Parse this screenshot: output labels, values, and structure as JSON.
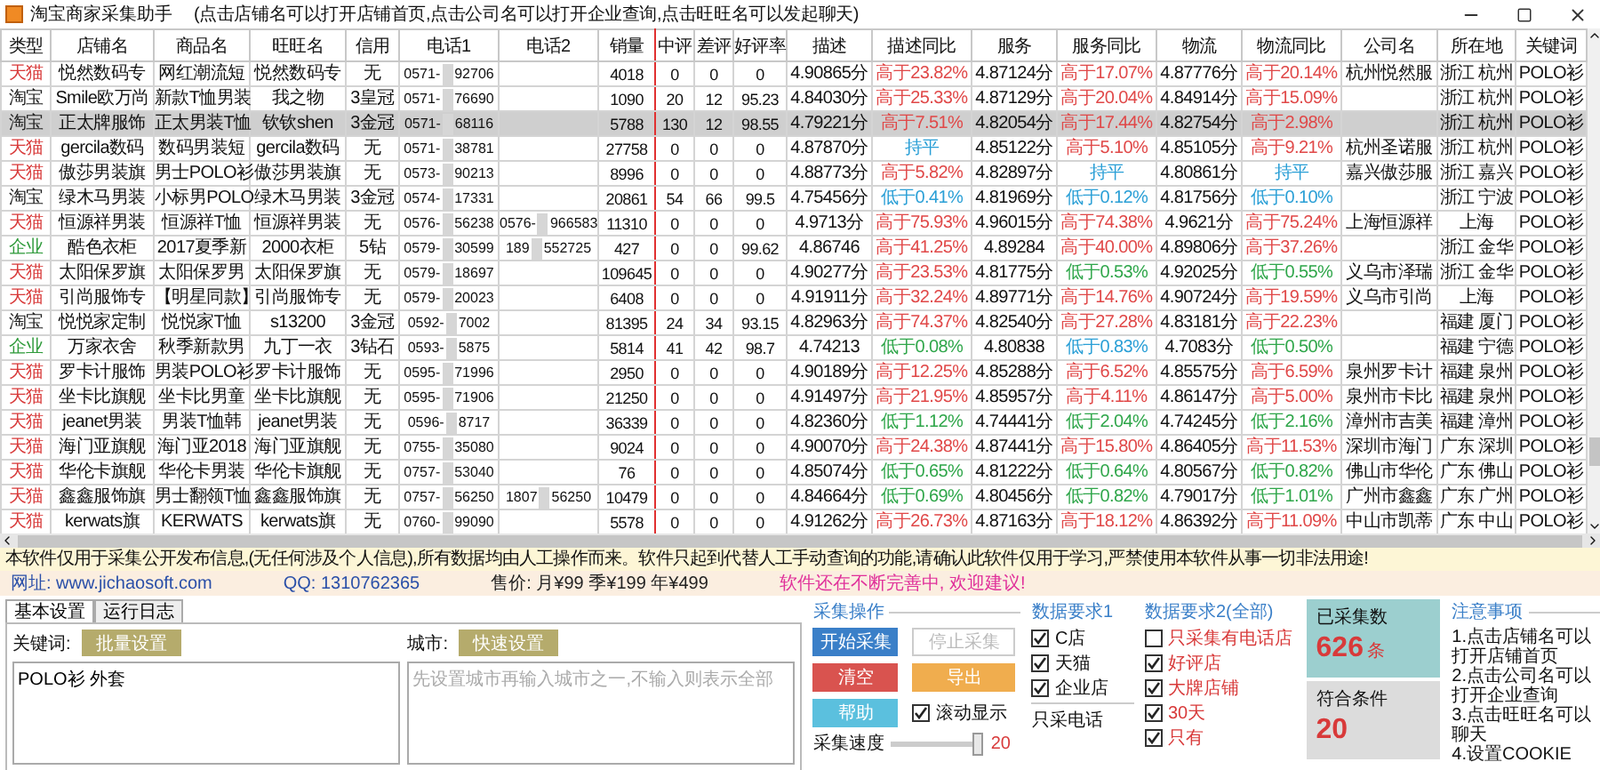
{
  "window": {
    "title": "淘宝商家采集助手",
    "hint": "(点击店铺名可以打开店铺首页,点击公司名可以打开企业查询,点击旺旺名可以发起聊天)"
  },
  "table": {
    "columns": [
      "类型",
      "店铺名",
      "商品名",
      "旺旺名",
      "信用",
      "电话1",
      "电话2",
      "销量",
      "中评",
      "差评",
      "好评率",
      "描述",
      "描述同比",
      "服务",
      "服务同比",
      "物流",
      "物流同比",
      "公司名",
      "所在地",
      "关键词"
    ],
    "rows": [
      {
        "selected": false,
        "type": {
          "text": "天猫",
          "kind": "tmall"
        },
        "shop": "悦然数码专",
        "item": "网红潮流短",
        "wangwang": "悦然数码专",
        "credit": "无",
        "phone1": {
          "prefix": "0571-",
          "suffix": "92706"
        },
        "sales": "4018",
        "mid": "0",
        "bad": "0",
        "rate": "0",
        "desc": "4.90865分",
        "desc_cmp": {
          "text": "高于23.82%",
          "kind": "up"
        },
        "service": "4.87124分",
        "service_cmp": {
          "text": "高于17.07%",
          "kind": "up"
        },
        "logistics": "4.87776分",
        "logistics_cmp": {
          "text": "高于20.14%",
          "kind": "up"
        },
        "company": "杭州悦然服",
        "location": "浙江 杭州",
        "keyword": "POLO衫"
      },
      {
        "selected": false,
        "type": {
          "text": "淘宝",
          "kind": "taobao"
        },
        "shop": "Smile欧万尚",
        "item": "新款T恤男装",
        "wangwang": "我之物",
        "credit": "3皇冠",
        "phone1": {
          "prefix": "0571-",
          "suffix": "76690"
        },
        "sales": "1090",
        "mid": "20",
        "bad": "12",
        "rate": "95.23",
        "desc": "4.84030分",
        "desc_cmp": {
          "text": "高于25.33%",
          "kind": "up"
        },
        "service": "4.87129分",
        "service_cmp": {
          "text": "高于20.04%",
          "kind": "up"
        },
        "logistics": "4.84914分",
        "logistics_cmp": {
          "text": "高于15.09%",
          "kind": "up"
        },
        "location": "浙江 杭州",
        "keyword": "POLO衫"
      },
      {
        "selected": true,
        "type": {
          "text": "淘宝",
          "kind": "taobao"
        },
        "shop": "正太牌服饰",
        "item": "正太男装T恤",
        "wangwang": "钦钦shen",
        "credit": "3金冠",
        "phone1": {
          "prefix": "0571-",
          "suffix": "68116"
        },
        "sales": "5788",
        "mid": "130",
        "bad": "12",
        "rate": "98.55",
        "desc": "4.79221分",
        "desc_cmp": {
          "text": "高于7.51%",
          "kind": "up"
        },
        "service": "4.82054分",
        "service_cmp": {
          "text": "高于17.44%",
          "kind": "up"
        },
        "logistics": "4.82754分",
        "logistics_cmp": {
          "text": "高于2.98%",
          "kind": "up"
        },
        "location": "浙江 杭州",
        "keyword": "POLO衫"
      },
      {
        "selected": false,
        "type": {
          "text": "天猫",
          "kind": "tmall"
        },
        "shop": "gercila数码",
        "item": "数码男装短",
        "wangwang": "gercila数码",
        "credit": "无",
        "phone1": {
          "prefix": "0571-",
          "suffix": "38781"
        },
        "sales": "27758",
        "mid": "0",
        "bad": "0",
        "rate": "0",
        "desc": "4.87870分",
        "desc_cmp": {
          "text": "持平",
          "kind": "flat"
        },
        "service": "4.85122分",
        "service_cmp": {
          "text": "高于5.10%",
          "kind": "up"
        },
        "logistics": "4.85105分",
        "logistics_cmp": {
          "text": "高于9.21%",
          "kind": "up"
        },
        "company": "杭州圣诺服",
        "location": "浙江 杭州",
        "keyword": "POLO衫"
      },
      {
        "selected": false,
        "type": {
          "text": "天猫",
          "kind": "tmall"
        },
        "shop": "傲莎男装旗",
        "item": "男士POLO衫",
        "wangwang": "傲莎男装旗",
        "credit": "无",
        "phone1": {
          "prefix": "0573-",
          "suffix": "90213"
        },
        "sales": "8996",
        "mid": "0",
        "bad": "0",
        "rate": "0",
        "desc": "4.88773分",
        "desc_cmp": {
          "text": "高于5.82%",
          "kind": "up"
        },
        "service": "4.82897分",
        "service_cmp": {
          "text": "持平",
          "kind": "flat"
        },
        "logistics": "4.80861分",
        "logistics_cmp": {
          "text": "持平",
          "kind": "flat"
        },
        "company": "嘉兴傲莎服",
        "location": "浙江 嘉兴",
        "keyword": "POLO衫"
      },
      {
        "selected": false,
        "type": {
          "text": "淘宝",
          "kind": "taobao"
        },
        "shop": "绿木马男装",
        "item": "小标男POLO",
        "wangwang": "绿木马男装",
        "credit": "3金冠",
        "phone1": {
          "prefix": "0574-",
          "suffix": "17331"
        },
        "sales": "20861",
        "mid": "54",
        "bad": "66",
        "rate": "99.5",
        "desc": "4.75456分",
        "desc_cmp": {
          "text": "低于0.41%",
          "kind": "flat"
        },
        "service": "4.81969分",
        "service_cmp": {
          "text": "低于0.12%",
          "kind": "flat"
        },
        "logistics": "4.81756分",
        "logistics_cmp": {
          "text": "低于0.10%",
          "kind": "flat"
        },
        "location": "浙江 宁波",
        "keyword": "POLO衫"
      },
      {
        "selected": false,
        "type": {
          "text": "天猫",
          "kind": "tmall"
        },
        "shop": "恒源祥男装",
        "item": "恒源祥T恤",
        "wangwang": "恒源祥男装",
        "credit": "无",
        "phone1": {
          "prefix": "0576-",
          "suffix": "56238"
        },
        "phone2": {
          "prefix": "0576-",
          "suffix": "966583"
        },
        "sales": "11310",
        "mid": "0",
        "bad": "0",
        "rate": "0",
        "desc": "4.9713分",
        "desc_cmp": {
          "text": "高于75.93%",
          "kind": "up"
        },
        "service": "4.96015分",
        "service_cmp": {
          "text": "高于74.38%",
          "kind": "up"
        },
        "logistics": "4.9621分",
        "logistics_cmp": {
          "text": "高于75.24%",
          "kind": "up"
        },
        "company": "上海恒源祥",
        "location": "上海",
        "keyword": "POLO衫"
      },
      {
        "selected": false,
        "type": {
          "text": "企业",
          "kind": "enterprise"
        },
        "shop": "酷色衣柜",
        "item": "2017夏季新",
        "wangwang": "2000衣柜",
        "credit": "5钻",
        "phone1": {
          "prefix": "0579-",
          "suffix": "30599"
        },
        "phone2": {
          "prefix": "189",
          "suffix": "552725"
        },
        "sales": "427",
        "mid": "0",
        "bad": "0",
        "rate": "99.62",
        "desc": "4.86746",
        "desc_cmp": {
          "text": "高于41.25%",
          "kind": "up"
        },
        "service": "4.89284",
        "service_cmp": {
          "text": "高于40.00%",
          "kind": "up"
        },
        "logistics": "4.89806分",
        "logistics_cmp": {
          "text": "高于37.26%",
          "kind": "up"
        },
        "location": "浙江 金华",
        "keyword": "POLO衫"
      },
      {
        "selected": false,
        "type": {
          "text": "天猫",
          "kind": "tmall"
        },
        "shop": "太阳保罗旗",
        "item": "太阳保罗男",
        "wangwang": "太阳保罗旗",
        "credit": "无",
        "phone1": {
          "prefix": "0579-",
          "suffix": "18697"
        },
        "sales": "109645",
        "mid": "0",
        "bad": "0",
        "rate": "0",
        "desc": "4.90277分",
        "desc_cmp": {
          "text": "高于23.53%",
          "kind": "up"
        },
        "service": "4.81775分",
        "service_cmp": {
          "text": "低于0.53%",
          "kind": "down"
        },
        "logistics": "4.92025分",
        "logistics_cmp": {
          "text": "低于0.55%",
          "kind": "down"
        },
        "company": "义乌市泽瑞",
        "location": "浙江 金华",
        "keyword": "POLO衫"
      },
      {
        "selected": false,
        "type": {
          "text": "天猫",
          "kind": "tmall"
        },
        "shop": "引尚服饰专",
        "item": "【明星同款】",
        "wangwang": "引尚服饰专",
        "credit": "无",
        "phone1": {
          "prefix": "0579-",
          "suffix": "20023"
        },
        "sales": "6408",
        "mid": "0",
        "bad": "0",
        "rate": "0",
        "desc": "4.91911分",
        "desc_cmp": {
          "text": "高于32.24%",
          "kind": "up"
        },
        "service": "4.89771分",
        "service_cmp": {
          "text": "高于14.76%",
          "kind": "up"
        },
        "logistics": "4.90724分",
        "logistics_cmp": {
          "text": "高于19.59%",
          "kind": "up"
        },
        "company": "义乌市引尚",
        "location": "上海",
        "keyword": "POLO衫"
      },
      {
        "selected": false,
        "type": {
          "text": "淘宝",
          "kind": "taobao"
        },
        "shop": "悦悦家定制",
        "item": "悦悦家T恤",
        "wangwang": "s13200",
        "credit": "3金冠",
        "phone1": {
          "prefix": "0592-",
          "suffix": "7002"
        },
        "sales": "81395",
        "mid": "24",
        "bad": "34",
        "rate": "93.15",
        "desc": "4.82963分",
        "desc_cmp": {
          "text": "高于74.37%",
          "kind": "up"
        },
        "service": "4.82540分",
        "service_cmp": {
          "text": "高于27.28%",
          "kind": "up"
        },
        "logistics": "4.83181分",
        "logistics_cmp": {
          "text": "高于22.23%",
          "kind": "up"
        },
        "location": "福建 厦门",
        "keyword": "POLO衫"
      },
      {
        "selected": false,
        "type": {
          "text": "企业",
          "kind": "enterprise"
        },
        "shop": "万家衣舍",
        "item": "秋季新款男",
        "wangwang": "九丁一衣",
        "credit": "3钻石",
        "phone1": {
          "prefix": "0593-",
          "suffix": "5875"
        },
        "sales": "5814",
        "mid": "41",
        "bad": "42",
        "rate": "98.7",
        "desc": "4.74213",
        "desc_cmp": {
          "text": "低于0.08%",
          "kind": "down"
        },
        "service": "4.80838",
        "service_cmp": {
          "text": "低于0.83%",
          "kind": "flat"
        },
        "logistics": "4.7083分",
        "logistics_cmp": {
          "text": "低于0.50%",
          "kind": "down"
        },
        "location": "福建 宁德",
        "keyword": "POLO衫"
      },
      {
        "selected": false,
        "type": {
          "text": "天猫",
          "kind": "tmall"
        },
        "shop": "罗卡计服饰",
        "item": "男装POLO衫",
        "wangwang": "罗卡计服饰",
        "credit": "无",
        "phone1": {
          "prefix": "0595-",
          "suffix": "71996"
        },
        "sales": "2950",
        "mid": "0",
        "bad": "0",
        "rate": "0",
        "desc": "4.90189分",
        "desc_cmp": {
          "text": "高于12.25%",
          "kind": "up"
        },
        "service": "4.85288分",
        "service_cmp": {
          "text": "高于6.52%",
          "kind": "up"
        },
        "logistics": "4.85575分",
        "logistics_cmp": {
          "text": "高于6.59%",
          "kind": "up"
        },
        "company": "泉州罗卡计",
        "location": "福建 泉州",
        "keyword": "POLO衫"
      },
      {
        "selected": false,
        "type": {
          "text": "天猫",
          "kind": "tmall"
        },
        "shop": "坐卡比旗舰",
        "item": "坐卡比男童",
        "wangwang": "坐卡比旗舰",
        "credit": "无",
        "phone1": {
          "prefix": "0595-",
          "suffix": "71906"
        },
        "sales": "21250",
        "mid": "0",
        "bad": "0",
        "rate": "0",
        "desc": "4.91497分",
        "desc_cmp": {
          "text": "高于21.95%",
          "kind": "up"
        },
        "service": "4.85957分",
        "service_cmp": {
          "text": "高于4.11%",
          "kind": "up"
        },
        "logistics": "4.86147分",
        "logistics_cmp": {
          "text": "高于5.00%",
          "kind": "up"
        },
        "company": "泉州市卡比",
        "location": "福建 泉州",
        "keyword": "POLO衫"
      },
      {
        "selected": false,
        "type": {
          "text": "天猫",
          "kind": "tmall"
        },
        "shop": "jeanet男装",
        "item": "男装T恤韩",
        "wangwang": "jeanet男装",
        "credit": "无",
        "phone1": {
          "prefix": "0596-",
          "suffix": "8717"
        },
        "sales": "36339",
        "mid": "0",
        "bad": "0",
        "rate": "0",
        "desc": "4.82360分",
        "desc_cmp": {
          "text": "低于1.12%",
          "kind": "down"
        },
        "service": "4.74441分",
        "service_cmp": {
          "text": "低于2.04%",
          "kind": "down"
        },
        "logistics": "4.74245分",
        "logistics_cmp": {
          "text": "低于2.16%",
          "kind": "down"
        },
        "company": "漳州市吉美",
        "location": "福建 漳州",
        "keyword": "POLO衫"
      },
      {
        "selected": false,
        "type": {
          "text": "天猫",
          "kind": "tmall"
        },
        "shop": "海门亚旗舰",
        "item": "海门亚2018",
        "wangwang": "海门亚旗舰",
        "credit": "无",
        "phone1": {
          "prefix": "0755-",
          "suffix": "35080"
        },
        "sales": "9024",
        "mid": "0",
        "bad": "0",
        "rate": "0",
        "desc": "4.90070分",
        "desc_cmp": {
          "text": "高于24.38%",
          "kind": "up"
        },
        "service": "4.87441分",
        "service_cmp": {
          "text": "高于15.80%",
          "kind": "up"
        },
        "logistics": "4.86405分",
        "logistics_cmp": {
          "text": "高于11.53%",
          "kind": "up"
        },
        "company": "深圳市海门",
        "location": "广东 深圳",
        "keyword": "POLO衫"
      },
      {
        "selected": false,
        "type": {
          "text": "天猫",
          "kind": "tmall"
        },
        "shop": "华伦卡旗舰",
        "item": "华伦卡男装",
        "wangwang": "华伦卡旗舰",
        "credit": "无",
        "phone1": {
          "prefix": "0757-",
          "suffix": "53040"
        },
        "sales": "76",
        "mid": "0",
        "bad": "0",
        "rate": "0",
        "desc": "4.85074分",
        "desc_cmp": {
          "text": "低于0.65%",
          "kind": "down"
        },
        "service": "4.81222分",
        "service_cmp": {
          "text": "低于0.64%",
          "kind": "down"
        },
        "logistics": "4.80567分",
        "logistics_cmp": {
          "text": "低于0.82%",
          "kind": "down"
        },
        "company": "佛山市华伦",
        "location": "广东 佛山",
        "keyword": "POLO衫"
      },
      {
        "selected": false,
        "type": {
          "text": "天猫",
          "kind": "tmall"
        },
        "shop": "鑫鑫服饰旗",
        "item": "男士翻领T恤",
        "wangwang": "鑫鑫服饰旗",
        "credit": "无",
        "phone1": {
          "prefix": "0757-",
          "suffix": "56250"
        },
        "phone2": {
          "prefix": "1807",
          "suffix": "56250"
        },
        "sales": "10479",
        "mid": "0",
        "bad": "0",
        "rate": "0",
        "desc": "4.84664分",
        "desc_cmp": {
          "text": "低于0.69%",
          "kind": "down"
        },
        "service": "4.80456分",
        "service_cmp": {
          "text": "低于0.82%",
          "kind": "down"
        },
        "logistics": "4.79017分",
        "logistics_cmp": {
          "text": "低于1.01%",
          "kind": "down"
        },
        "company": "广州市鑫鑫",
        "location": "广东 广州",
        "keyword": "POLO衫"
      },
      {
        "selected": false,
        "type": {
          "text": "天猫",
          "kind": "tmall"
        },
        "shop": "kerwats旗",
        "item": "KERWATS",
        "wangwang": "kerwats旗",
        "credit": "无",
        "phone1": {
          "prefix": "0760-",
          "suffix": "99090"
        },
        "sales": "5578",
        "mid": "0",
        "bad": "0",
        "rate": "0",
        "desc": "4.91262分",
        "desc_cmp": {
          "text": "高于26.73%",
          "kind": "up"
        },
        "service": "4.87163分",
        "service_cmp": {
          "text": "高于18.12%",
          "kind": "up"
        },
        "logistics": "4.86392分",
        "logistics_cmp": {
          "text": "高于11.09%",
          "kind": "up"
        },
        "company": "中山市凯蒂",
        "location": "广东 中山",
        "keyword": "POLO衫"
      }
    ]
  },
  "notice": "本软件仅用于采集公开发布信息,(无任何涉及个人信息),所有数据均由人工操作而来。软件只起到代替人工手动查询的功能,请确认此软件仅用于学习,严禁使用本软件从事一切非法用途!",
  "info": {
    "site": "网址: www.jichaosoft.com",
    "qq": "QQ: 1310762365",
    "price": "售价: 月¥99 季¥199 年¥499",
    "slogan": "软件还在不断完善中, 欢迎建议!"
  },
  "settings": {
    "tabs": [
      {
        "label": "基本设置",
        "selected": true
      },
      {
        "label": "运行日志",
        "selected": false
      }
    ],
    "keywords": {
      "label": "关键词:",
      "button": "批量设置",
      "value": "POLO衫 外套"
    },
    "cities": {
      "label": "城市:",
      "button": "快速设置",
      "placeholder": "先设置城市再输入城市之一,不输入则表示全部"
    }
  },
  "operations": {
    "title": "采集操作",
    "buttons": [
      {
        "label": "开始采集",
        "kind": "primary"
      },
      {
        "label": "停止采集",
        "kind": "disabled"
      },
      {
        "label": "清空",
        "kind": "danger"
      },
      {
        "label": "导出",
        "kind": "warning"
      },
      {
        "label": "帮助",
        "kind": "info"
      }
    ],
    "scroll_option": {
      "label": "滚动显示",
      "checked": true
    },
    "speed": {
      "label": "采集速度",
      "level": 1,
      "reading": "20"
    }
  },
  "requirements_1": {
    "title": "数据要求1",
    "items": [
      {
        "label": "C店",
        "checked": true
      },
      {
        "label": "天猫",
        "checked": true
      },
      {
        "label": "企业店",
        "checked": true
      }
    ],
    "note": "只采电话"
  },
  "requirements_2": {
    "title": "数据要求2(全部)",
    "items": [
      {
        "label": "只采集有电话店",
        "checked": false
      },
      {
        "label": "好评店",
        "checked": true
      },
      {
        "label": "大牌店铺",
        "checked": true
      },
      {
        "label": "30天",
        "checked": true
      },
      {
        "label": "只有",
        "checked": true
      }
    ]
  },
  "stats": [
    {
      "label": "已采集数",
      "value": "626",
      "unit": "条",
      "kind": "teal"
    },
    {
      "label": "符合条件",
      "value": "20",
      "kind": "grey"
    }
  ],
  "notes": {
    "title": "注意事项",
    "items": [
      "1.点击店铺名可以打开店铺首页",
      "2.点击公司名可以打开企业查询",
      "3.点击旺旺名可以聊天",
      "4.设置COOKIE"
    ]
  }
}
